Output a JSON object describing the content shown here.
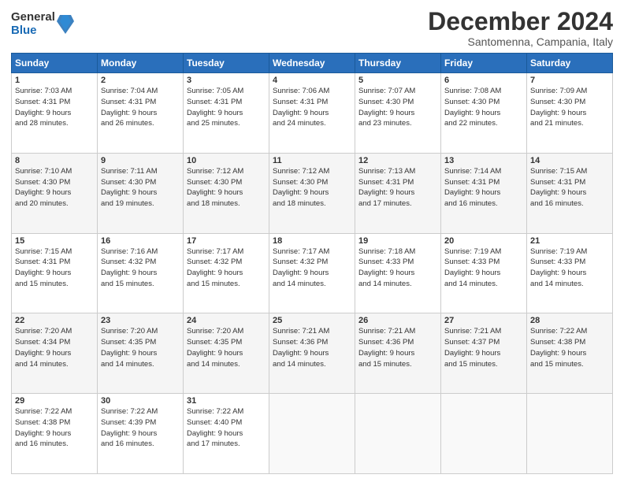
{
  "logo": {
    "general": "General",
    "blue": "Blue"
  },
  "title": "December 2024",
  "location": "Santomenna, Campania, Italy",
  "headers": [
    "Sunday",
    "Monday",
    "Tuesday",
    "Wednesday",
    "Thursday",
    "Friday",
    "Saturday"
  ],
  "weeks": [
    [
      {
        "day": "1",
        "info": "Sunrise: 7:03 AM\nSunset: 4:31 PM\nDaylight: 9 hours\nand 28 minutes."
      },
      {
        "day": "2",
        "info": "Sunrise: 7:04 AM\nSunset: 4:31 PM\nDaylight: 9 hours\nand 26 minutes."
      },
      {
        "day": "3",
        "info": "Sunrise: 7:05 AM\nSunset: 4:31 PM\nDaylight: 9 hours\nand 25 minutes."
      },
      {
        "day": "4",
        "info": "Sunrise: 7:06 AM\nSunset: 4:31 PM\nDaylight: 9 hours\nand 24 minutes."
      },
      {
        "day": "5",
        "info": "Sunrise: 7:07 AM\nSunset: 4:30 PM\nDaylight: 9 hours\nand 23 minutes."
      },
      {
        "day": "6",
        "info": "Sunrise: 7:08 AM\nSunset: 4:30 PM\nDaylight: 9 hours\nand 22 minutes."
      },
      {
        "day": "7",
        "info": "Sunrise: 7:09 AM\nSunset: 4:30 PM\nDaylight: 9 hours\nand 21 minutes."
      }
    ],
    [
      {
        "day": "8",
        "info": "Sunrise: 7:10 AM\nSunset: 4:30 PM\nDaylight: 9 hours\nand 20 minutes."
      },
      {
        "day": "9",
        "info": "Sunrise: 7:11 AM\nSunset: 4:30 PM\nDaylight: 9 hours\nand 19 minutes."
      },
      {
        "day": "10",
        "info": "Sunrise: 7:12 AM\nSunset: 4:30 PM\nDaylight: 9 hours\nand 18 minutes."
      },
      {
        "day": "11",
        "info": "Sunrise: 7:12 AM\nSunset: 4:30 PM\nDaylight: 9 hours\nand 18 minutes."
      },
      {
        "day": "12",
        "info": "Sunrise: 7:13 AM\nSunset: 4:31 PM\nDaylight: 9 hours\nand 17 minutes."
      },
      {
        "day": "13",
        "info": "Sunrise: 7:14 AM\nSunset: 4:31 PM\nDaylight: 9 hours\nand 16 minutes."
      },
      {
        "day": "14",
        "info": "Sunrise: 7:15 AM\nSunset: 4:31 PM\nDaylight: 9 hours\nand 16 minutes."
      }
    ],
    [
      {
        "day": "15",
        "info": "Sunrise: 7:15 AM\nSunset: 4:31 PM\nDaylight: 9 hours\nand 15 minutes."
      },
      {
        "day": "16",
        "info": "Sunrise: 7:16 AM\nSunset: 4:32 PM\nDaylight: 9 hours\nand 15 minutes."
      },
      {
        "day": "17",
        "info": "Sunrise: 7:17 AM\nSunset: 4:32 PM\nDaylight: 9 hours\nand 15 minutes."
      },
      {
        "day": "18",
        "info": "Sunrise: 7:17 AM\nSunset: 4:32 PM\nDaylight: 9 hours\nand 14 minutes."
      },
      {
        "day": "19",
        "info": "Sunrise: 7:18 AM\nSunset: 4:33 PM\nDaylight: 9 hours\nand 14 minutes."
      },
      {
        "day": "20",
        "info": "Sunrise: 7:19 AM\nSunset: 4:33 PM\nDaylight: 9 hours\nand 14 minutes."
      },
      {
        "day": "21",
        "info": "Sunrise: 7:19 AM\nSunset: 4:33 PM\nDaylight: 9 hours\nand 14 minutes."
      }
    ],
    [
      {
        "day": "22",
        "info": "Sunrise: 7:20 AM\nSunset: 4:34 PM\nDaylight: 9 hours\nand 14 minutes."
      },
      {
        "day": "23",
        "info": "Sunrise: 7:20 AM\nSunset: 4:35 PM\nDaylight: 9 hours\nand 14 minutes."
      },
      {
        "day": "24",
        "info": "Sunrise: 7:20 AM\nSunset: 4:35 PM\nDaylight: 9 hours\nand 14 minutes."
      },
      {
        "day": "25",
        "info": "Sunrise: 7:21 AM\nSunset: 4:36 PM\nDaylight: 9 hours\nand 14 minutes."
      },
      {
        "day": "26",
        "info": "Sunrise: 7:21 AM\nSunset: 4:36 PM\nDaylight: 9 hours\nand 15 minutes."
      },
      {
        "day": "27",
        "info": "Sunrise: 7:21 AM\nSunset: 4:37 PM\nDaylight: 9 hours\nand 15 minutes."
      },
      {
        "day": "28",
        "info": "Sunrise: 7:22 AM\nSunset: 4:38 PM\nDaylight: 9 hours\nand 15 minutes."
      }
    ],
    [
      {
        "day": "29",
        "info": "Sunrise: 7:22 AM\nSunset: 4:38 PM\nDaylight: 9 hours\nand 16 minutes."
      },
      {
        "day": "30",
        "info": "Sunrise: 7:22 AM\nSunset: 4:39 PM\nDaylight: 9 hours\nand 16 minutes."
      },
      {
        "day": "31",
        "info": "Sunrise: 7:22 AM\nSunset: 4:40 PM\nDaylight: 9 hours\nand 17 minutes."
      },
      {
        "day": "",
        "info": ""
      },
      {
        "day": "",
        "info": ""
      },
      {
        "day": "",
        "info": ""
      },
      {
        "day": "",
        "info": ""
      }
    ]
  ]
}
